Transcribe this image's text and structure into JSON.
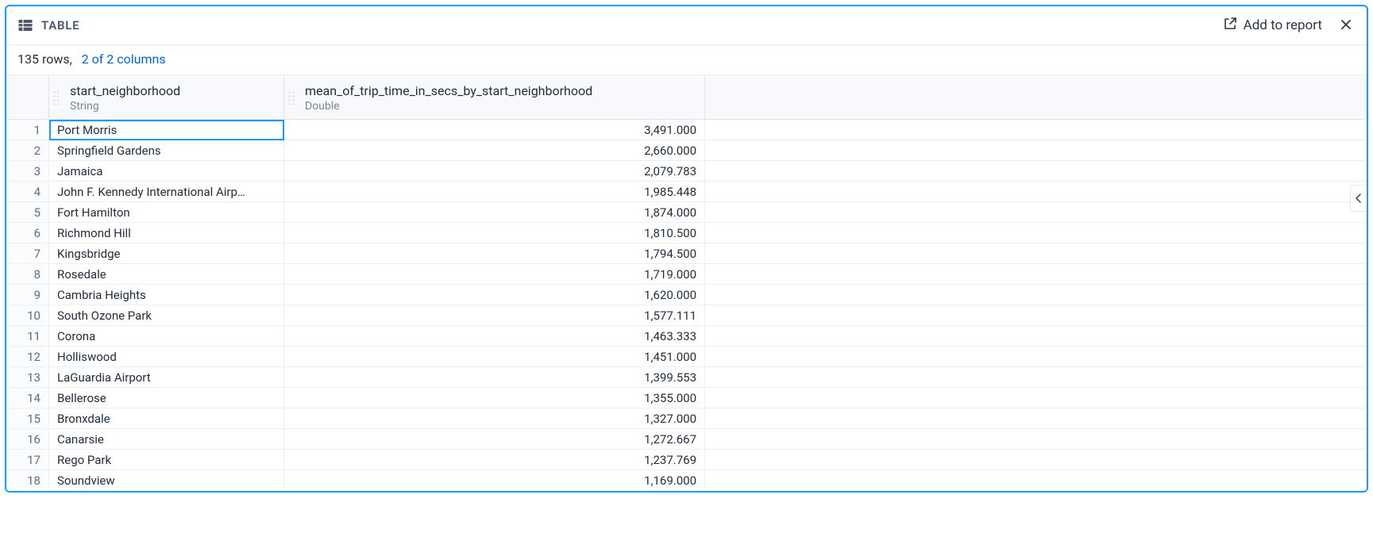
{
  "header": {
    "title": "TABLE",
    "add_to_report_label": "Add to report"
  },
  "meta": {
    "rows_label": "135 rows,",
    "columns_label": "2 of 2 columns"
  },
  "columns": [
    {
      "name": "start_neighborhood",
      "type": "String"
    },
    {
      "name": "mean_of_trip_time_in_secs_by_start_neighborhood",
      "type": "Double"
    }
  ],
  "rows": [
    {
      "n": 1,
      "c0": "Port Morris",
      "c1": "3,491.000"
    },
    {
      "n": 2,
      "c0": "Springfield Gardens",
      "c1": "2,660.000"
    },
    {
      "n": 3,
      "c0": "Jamaica",
      "c1": "2,079.783"
    },
    {
      "n": 4,
      "c0": "John F. Kennedy International Airp…",
      "c1": "1,985.448",
      "hot": true
    },
    {
      "n": 5,
      "c0": "Fort Hamilton",
      "c1": "1,874.000"
    },
    {
      "n": 6,
      "c0": "Richmond Hill",
      "c1": "1,810.500"
    },
    {
      "n": 7,
      "c0": "Kingsbridge",
      "c1": "1,794.500"
    },
    {
      "n": 8,
      "c0": "Rosedale",
      "c1": "1,719.000"
    },
    {
      "n": 9,
      "c0": "Cambria Heights",
      "c1": "1,620.000"
    },
    {
      "n": 10,
      "c0": "South Ozone Park",
      "c1": "1,577.111"
    },
    {
      "n": 11,
      "c0": "Corona",
      "c1": "1,463.333"
    },
    {
      "n": 12,
      "c0": "Holliswood",
      "c1": "1,451.000"
    },
    {
      "n": 13,
      "c0": "LaGuardia Airport",
      "c1": "1,399.553"
    },
    {
      "n": 14,
      "c0": "Bellerose",
      "c1": "1,355.000"
    },
    {
      "n": 15,
      "c0": "Bronxdale",
      "c1": "1,327.000"
    },
    {
      "n": 16,
      "c0": "Canarsie",
      "c1": "1,272.667"
    },
    {
      "n": 17,
      "c0": "Rego Park",
      "c1": "1,237.769"
    },
    {
      "n": 18,
      "c0": "Soundview",
      "c1": "1,169.000"
    }
  ],
  "selected_cell": {
    "row": 1,
    "col": 0
  }
}
